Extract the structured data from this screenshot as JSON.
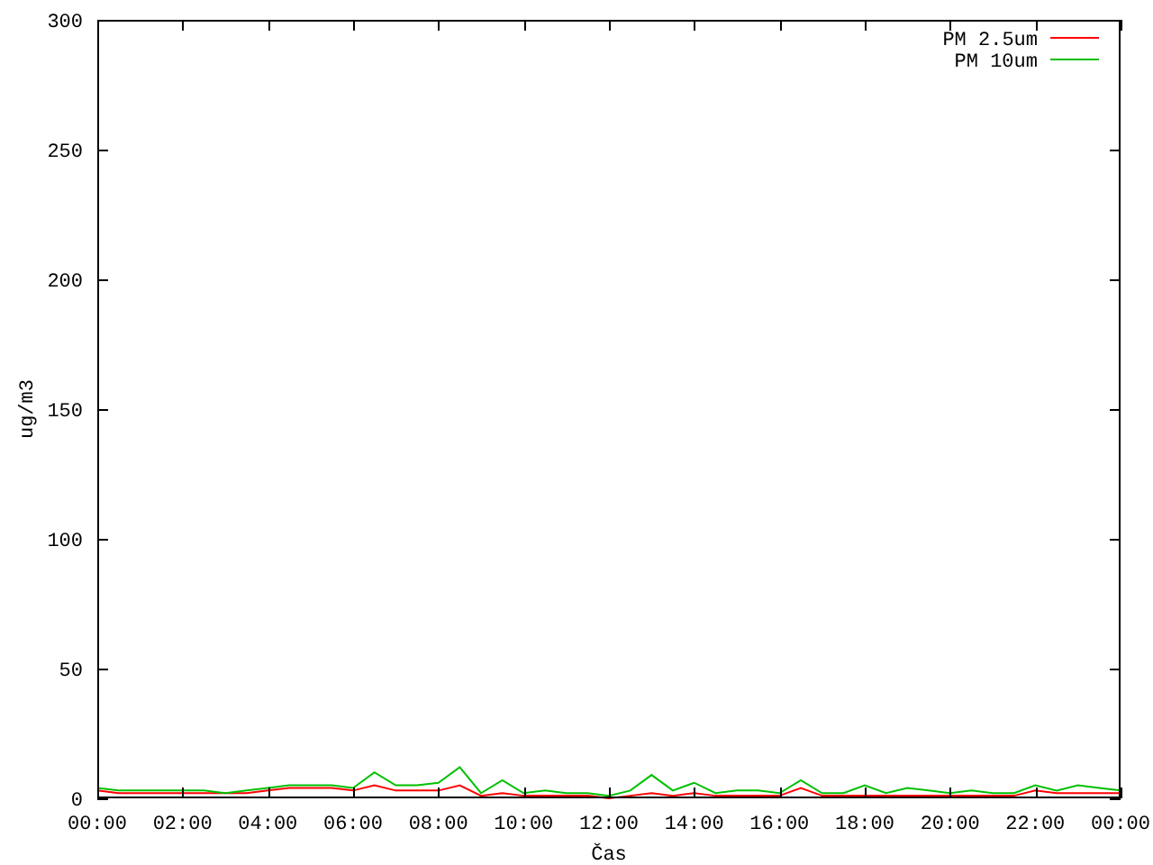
{
  "chart": {
    "chart_data": {
      "type": "line",
      "legend": "top-right",
      "xlabel": "Čas",
      "ylabel": "ug/m3",
      "xlim": [
        0,
        24
      ],
      "ylim": [
        0,
        300
      ],
      "x": [
        0,
        0.5,
        1,
        1.5,
        2,
        2.5,
        3,
        3.5,
        4,
        4.5,
        5,
        5.5,
        6,
        6.5,
        7,
        7.5,
        8,
        8.5,
        9,
        9.5,
        10,
        10.5,
        11,
        11.5,
        12,
        12.5,
        13,
        13.5,
        14,
        14.5,
        15,
        15.5,
        16,
        16.5,
        17,
        17.5,
        18,
        18.5,
        19,
        19.5,
        20,
        20.5,
        21,
        21.5,
        22,
        22.5,
        23,
        23.5,
        24
      ],
      "xticks": [
        {
          "value": 0,
          "label": "00:00"
        },
        {
          "value": 2,
          "label": "02:00"
        },
        {
          "value": 4,
          "label": "04:00"
        },
        {
          "value": 6,
          "label": "06:00"
        },
        {
          "value": 8,
          "label": "08:00"
        },
        {
          "value": 10,
          "label": "10:00"
        },
        {
          "value": 12,
          "label": "12:00"
        },
        {
          "value": 14,
          "label": "14:00"
        },
        {
          "value": 16,
          "label": "16:00"
        },
        {
          "value": 18,
          "label": "18:00"
        },
        {
          "value": 20,
          "label": "20:00"
        },
        {
          "value": 22,
          "label": "22:00"
        },
        {
          "value": 24,
          "label": "00:00"
        }
      ],
      "yticks": [
        0,
        50,
        100,
        150,
        200,
        250,
        300
      ],
      "series": [
        {
          "name": "PM 2.5um",
          "color": "#ff0000",
          "values": [
            3,
            2,
            2,
            2,
            2,
            2,
            2,
            2,
            3,
            4,
            4,
            4,
            3,
            5,
            3,
            3,
            3,
            5,
            1,
            2,
            1,
            1,
            1,
            1,
            0,
            1,
            2,
            1,
            2,
            1,
            1,
            1,
            1,
            4,
            1,
            1,
            1,
            1,
            1,
            1,
            1,
            1,
            1,
            1,
            3,
            2,
            2,
            2,
            2
          ]
        },
        {
          "name": "PM 10um",
          "color": "#00c000",
          "values": [
            4,
            3,
            3,
            3,
            3,
            3,
            2,
            3,
            4,
            5,
            5,
            5,
            4,
            10,
            5,
            5,
            6,
            12,
            2,
            7,
            2,
            3,
            2,
            2,
            1,
            3,
            9,
            3,
            6,
            2,
            3,
            3,
            2,
            7,
            2,
            2,
            5,
            2,
            4,
            3,
            2,
            3,
            2,
            2,
            5,
            3,
            5,
            4,
            3
          ]
        }
      ]
    }
  }
}
